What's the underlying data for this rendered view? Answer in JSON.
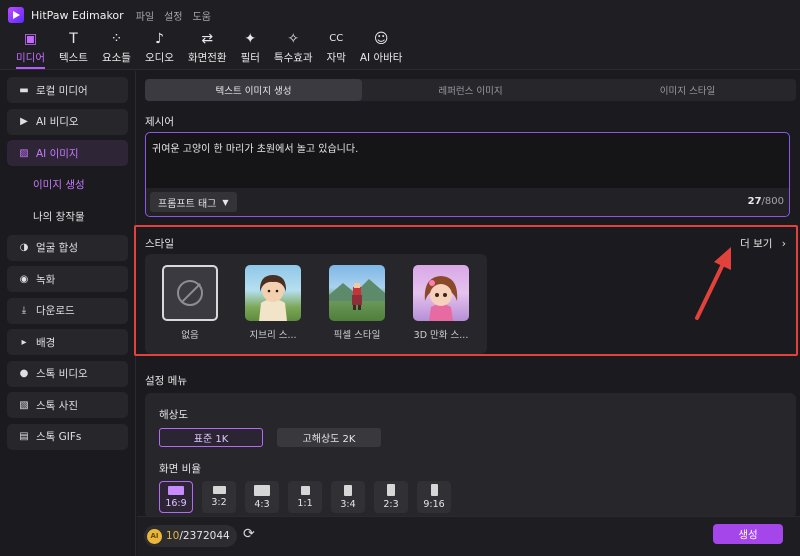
{
  "app": {
    "title": "HitPaw Edimakor",
    "menu": [
      "파일",
      "설정",
      "도움"
    ]
  },
  "toolbar": [
    {
      "label": "미디어",
      "icon": "media-icon",
      "glyph": "▣",
      "active": true
    },
    {
      "label": "텍스트",
      "icon": "text-icon",
      "glyph": "T",
      "active": false
    },
    {
      "label": "요소들",
      "icon": "elements-icon",
      "glyph": "⁘",
      "active": false
    },
    {
      "label": "오디오",
      "icon": "audio-icon",
      "glyph": "♪",
      "active": false
    },
    {
      "label": "화면전환",
      "icon": "transition-icon",
      "glyph": "⇄",
      "active": false
    },
    {
      "label": "필터",
      "icon": "filter-icon",
      "glyph": "✦",
      "active": false
    },
    {
      "label": "특수효과",
      "icon": "effects-icon",
      "glyph": "✧",
      "active": false
    },
    {
      "label": "자막",
      "icon": "subtitle-icon",
      "glyph": "CC",
      "active": false
    },
    {
      "label": "AI 아바타",
      "icon": "ai-avatar-icon",
      "glyph": "☺",
      "active": false
    }
  ],
  "sidebar": {
    "items": [
      {
        "label": "로컬 미디어",
        "icon": "folder-icon",
        "glyph": "▬"
      },
      {
        "label": "AI 비디오",
        "icon": "ai-video-icon",
        "glyph": "▶"
      },
      {
        "label": "AI 이미지",
        "icon": "ai-image-icon",
        "glyph": "▨",
        "active": true
      },
      {
        "label": "이미지 생성",
        "sub": true,
        "active": true
      },
      {
        "label": "나의 창작물",
        "sub": true
      },
      {
        "label": "얼굴 합성",
        "icon": "face-swap-icon",
        "glyph": "◑"
      },
      {
        "label": "녹화",
        "icon": "record-icon",
        "glyph": "◉"
      },
      {
        "label": "다운로드",
        "icon": "download-icon",
        "glyph": "⤓"
      },
      {
        "label": "배경",
        "icon": "background-icon",
        "glyph": "▸"
      },
      {
        "label": "스톡 비디오",
        "icon": "stock-video-icon",
        "glyph": "●"
      },
      {
        "label": "스톡 사진",
        "icon": "stock-photo-icon",
        "glyph": "▧"
      },
      {
        "label": "스톡 GIFs",
        "icon": "gif-icon",
        "glyph": "▤"
      }
    ]
  },
  "tabs": [
    {
      "label": "텍스트 이미지 생성",
      "active": true
    },
    {
      "label": "레퍼런스 이미지",
      "active": false
    },
    {
      "label": "이미지 스타일",
      "active": false
    }
  ],
  "prompt": {
    "label": "제시어",
    "value": "귀여운 고양이 한 마리가 초원에서 놀고 있습니다.",
    "tag_button": "프롬프트 태그",
    "count": "27",
    "max": "/800"
  },
  "style": {
    "label": "스타일",
    "more": "더 보기",
    "cards": [
      {
        "label": "없음",
        "kind": "none"
      },
      {
        "label": "지브리 스...",
        "kind": "ghibli"
      },
      {
        "label": "픽셀 스타일",
        "kind": "pixel"
      },
      {
        "label": "3D 만화 스...",
        "kind": "toon"
      }
    ]
  },
  "settings": {
    "label": "설정 메뉴",
    "resolution_label": "해상도",
    "resolutions": [
      {
        "label": "표준 1K",
        "active": true
      },
      {
        "label": "고해상도 2K",
        "active": false
      }
    ],
    "ratio_label": "화면 비율",
    "ratios": [
      {
        "label": "16:9",
        "active": true
      },
      {
        "label": "3:2"
      },
      {
        "label": "4:3"
      },
      {
        "label": "1:1"
      },
      {
        "label": "3:4"
      },
      {
        "label": "2:3"
      },
      {
        "label": "9:16"
      }
    ]
  },
  "footer": {
    "credits_used": "10",
    "credits_total": "/2372044",
    "generate": "생성"
  },
  "colors": {
    "accent": "#a546ea",
    "highlight": "#e2423b"
  }
}
